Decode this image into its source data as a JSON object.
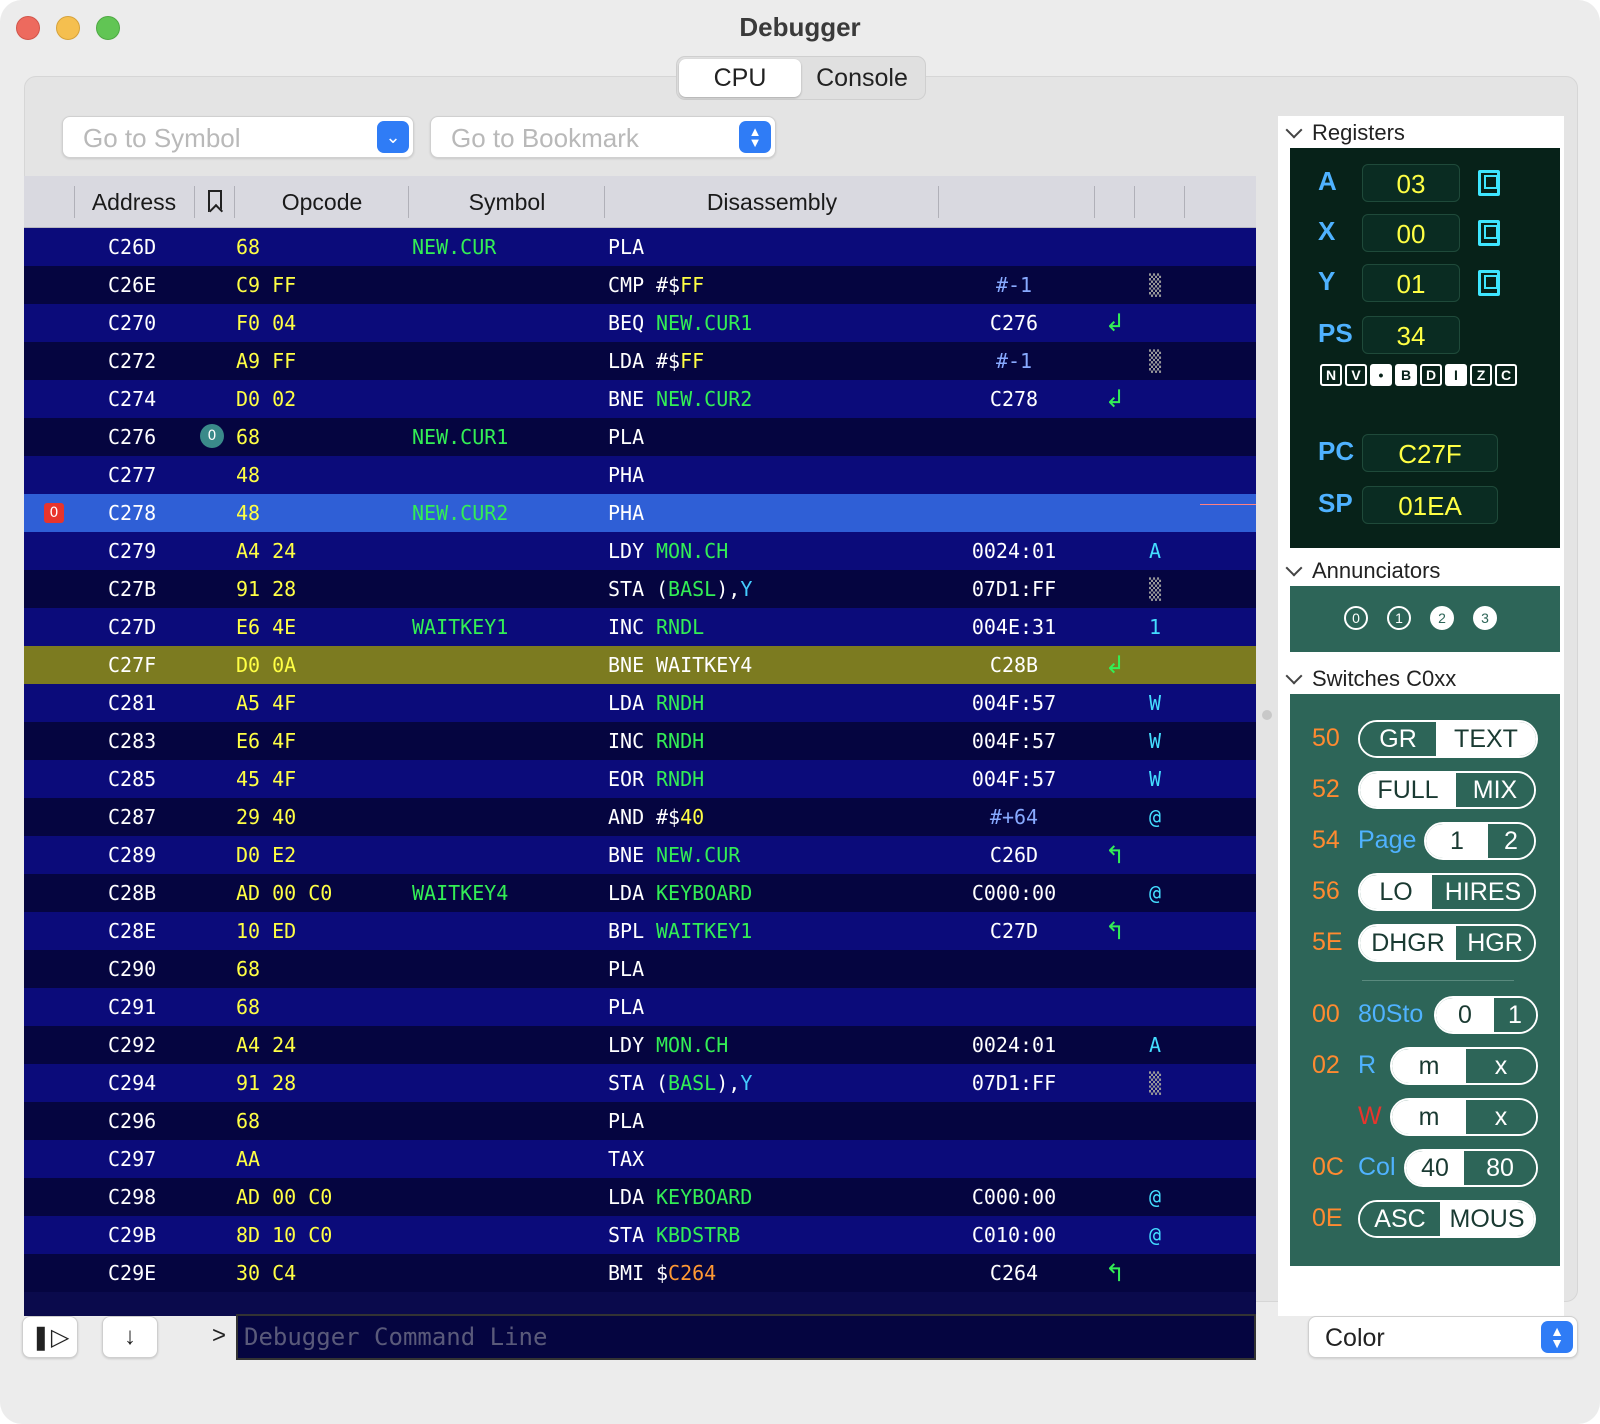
{
  "window": {
    "title": "Debugger"
  },
  "tabs": [
    {
      "label": "CPU",
      "active": true
    },
    {
      "label": "Console",
      "active": false
    }
  ],
  "goto_symbol": {
    "placeholder": "Go to Symbol"
  },
  "goto_bookmark": {
    "placeholder": "Go to Bookmark"
  },
  "columns": {
    "address": "Address",
    "opcode": "Opcode",
    "symbol": "Symbol",
    "disassembly": "Disassembly"
  },
  "rows": [
    {
      "addr": "C26D",
      "op": "68",
      "sym": "NEW.CUR",
      "mn": "PLA",
      "arg": "",
      "argc": "",
      "tgt": "",
      "imm": false,
      "br": "",
      "ch": "",
      "chc": ""
    },
    {
      "addr": "C26E",
      "op": "C9 FF",
      "sym": "",
      "mn": "CMP",
      "arg": "#$FF",
      "argc": "yellow",
      "tgt": "#-1",
      "imm": true,
      "br": "",
      "ch": "▒",
      "chc": "gray"
    },
    {
      "addr": "C270",
      "op": "F0 04",
      "sym": "",
      "mn": "BEQ",
      "arg": "NEW.CUR1",
      "argc": "green",
      "tgt": "C276",
      "imm": false,
      "br": "↲",
      "ch": "",
      "chc": ""
    },
    {
      "addr": "C272",
      "op": "A9 FF",
      "sym": "",
      "mn": "LDA",
      "arg": "#$FF",
      "argc": "yellow",
      "tgt": "#-1",
      "imm": true,
      "br": "",
      "ch": "▒",
      "chc": "gray"
    },
    {
      "addr": "C274",
      "op": "D0 02",
      "sym": "",
      "mn": "BNE",
      "arg": "NEW.CUR2",
      "argc": "green",
      "tgt": "C278",
      "imm": false,
      "br": "↲",
      "ch": "",
      "chc": ""
    },
    {
      "addr": "C276",
      "op": "68",
      "sym": "NEW.CUR1",
      "mn": "PLA",
      "arg": "",
      "argc": "",
      "tgt": "",
      "imm": false,
      "br": "",
      "ch": "",
      "chc": "",
      "bookmark": "0"
    },
    {
      "addr": "C277",
      "op": "48",
      "sym": "",
      "mn": "PHA",
      "arg": "",
      "argc": "",
      "tgt": "",
      "imm": false,
      "br": "",
      "ch": "",
      "chc": ""
    },
    {
      "addr": "C278",
      "op": "48",
      "sym": "NEW.CUR2",
      "mn": "PHA",
      "arg": "",
      "argc": "",
      "tgt": "",
      "imm": false,
      "br": "",
      "ch": "",
      "chc": "",
      "breakpoint": "0",
      "selected": true
    },
    {
      "addr": "C279",
      "op": "A4 24",
      "sym": "",
      "mn": "LDY",
      "arg": "MON.CH",
      "argc": "green",
      "tgt": "0024:01",
      "imm": false,
      "br": "",
      "ch": "A",
      "chc": ""
    },
    {
      "addr": "C27B",
      "op": "91 28",
      "sym": "",
      "mn": "STA",
      "arg": "(BASL),Y",
      "argc": "mixed",
      "tgt": "07D1:FF",
      "imm": false,
      "br": "",
      "ch": "▒",
      "chc": "gray"
    },
    {
      "addr": "C27D",
      "op": "E6 4E",
      "sym": "WAITKEY1",
      "mn": "INC",
      "arg": "RNDL",
      "argc": "green",
      "tgt": "004E:31",
      "imm": false,
      "br": "",
      "ch": "1",
      "chc": ""
    },
    {
      "addr": "C27F",
      "op": "D0 0A",
      "sym": "",
      "mn": "BNE",
      "arg": "WAITKEY4",
      "argc": "white",
      "tgt": "C28B",
      "imm": false,
      "br": "↲",
      "ch": "",
      "chc": "",
      "pc": true
    },
    {
      "addr": "C281",
      "op": "A5 4F",
      "sym": "",
      "mn": "LDA",
      "arg": "RNDH",
      "argc": "green",
      "tgt": "004F:57",
      "imm": false,
      "br": "",
      "ch": "W",
      "chc": ""
    },
    {
      "addr": "C283",
      "op": "E6 4F",
      "sym": "",
      "mn": "INC",
      "arg": "RNDH",
      "argc": "green",
      "tgt": "004F:57",
      "imm": false,
      "br": "",
      "ch": "W",
      "chc": ""
    },
    {
      "addr": "C285",
      "op": "45 4F",
      "sym": "",
      "mn": "EOR",
      "arg": "RNDH",
      "argc": "green",
      "tgt": "004F:57",
      "imm": false,
      "br": "",
      "ch": "W",
      "chc": ""
    },
    {
      "addr": "C287",
      "op": "29 40",
      "sym": "",
      "mn": "AND",
      "arg": "#$40",
      "argc": "yellow",
      "tgt": "#+64",
      "imm": true,
      "br": "",
      "ch": "@",
      "chc": ""
    },
    {
      "addr": "C289",
      "op": "D0 E2",
      "sym": "",
      "mn": "BNE",
      "arg": "NEW.CUR",
      "argc": "green",
      "tgt": "C26D",
      "imm": false,
      "br": "↰",
      "ch": "",
      "chc": ""
    },
    {
      "addr": "C28B",
      "op": "AD 00 C0",
      "sym": "WAITKEY4",
      "mn": "LDA",
      "arg": "KEYBOARD",
      "argc": "green",
      "tgt": "C000:00",
      "imm": false,
      "br": "",
      "ch": "@",
      "chc": ""
    },
    {
      "addr": "C28E",
      "op": "10 ED",
      "sym": "",
      "mn": "BPL",
      "arg": "WAITKEY1",
      "argc": "green",
      "tgt": "C27D",
      "imm": false,
      "br": "↰",
      "ch": "",
      "chc": ""
    },
    {
      "addr": "C290",
      "op": "68",
      "sym": "",
      "mn": "PLA",
      "arg": "",
      "argc": "",
      "tgt": "",
      "imm": false,
      "br": "",
      "ch": "",
      "chc": ""
    },
    {
      "addr": "C291",
      "op": "68",
      "sym": "",
      "mn": "PLA",
      "arg": "",
      "argc": "",
      "tgt": "",
      "imm": false,
      "br": "",
      "ch": "",
      "chc": ""
    },
    {
      "addr": "C292",
      "op": "A4 24",
      "sym": "",
      "mn": "LDY",
      "arg": "MON.CH",
      "argc": "green",
      "tgt": "0024:01",
      "imm": false,
      "br": "",
      "ch": "A",
      "chc": ""
    },
    {
      "addr": "C294",
      "op": "91 28",
      "sym": "",
      "mn": "STA",
      "arg": "(BASL),Y",
      "argc": "mixed",
      "tgt": "07D1:FF",
      "imm": false,
      "br": "",
      "ch": "▒",
      "chc": "gray"
    },
    {
      "addr": "C296",
      "op": "68",
      "sym": "",
      "mn": "PLA",
      "arg": "",
      "argc": "",
      "tgt": "",
      "imm": false,
      "br": "",
      "ch": "",
      "chc": ""
    },
    {
      "addr": "C297",
      "op": "AA",
      "sym": "",
      "mn": "TAX",
      "arg": "",
      "argc": "",
      "tgt": "",
      "imm": false,
      "br": "",
      "ch": "",
      "chc": ""
    },
    {
      "addr": "C298",
      "op": "AD 00 C0",
      "sym": "",
      "mn": "LDA",
      "arg": "KEYBOARD",
      "argc": "green",
      "tgt": "C000:00",
      "imm": false,
      "br": "",
      "ch": "@",
      "chc": ""
    },
    {
      "addr": "C29B",
      "op": "8D 10 C0",
      "sym": "",
      "mn": "STA",
      "arg": "KBDSTRB",
      "argc": "green",
      "tgt": "C010:00",
      "imm": false,
      "br": "",
      "ch": "@",
      "chc": ""
    },
    {
      "addr": "C29E",
      "op": "30 C4",
      "sym": "",
      "mn": "BMI",
      "arg": "$C264",
      "argc": "dollar-orange",
      "tgt": "C264",
      "imm": false,
      "br": "↰",
      "ch": "",
      "chc": ""
    }
  ],
  "registers": {
    "title": "Registers",
    "A": {
      "label": "A",
      "value": "03"
    },
    "X": {
      "label": "X",
      "value": "00"
    },
    "Y": {
      "label": "Y",
      "value": "01"
    },
    "PS": {
      "label": "PS",
      "value": "34"
    },
    "PC": {
      "label": "PC",
      "value": "C27F"
    },
    "SP": {
      "label": "SP",
      "value": "01EA"
    },
    "flags": [
      {
        "label": "N",
        "on": false
      },
      {
        "label": "V",
        "on": false
      },
      {
        "label": "•",
        "on": true
      },
      {
        "label": "B",
        "on": true
      },
      {
        "label": "D",
        "on": false
      },
      {
        "label": "I",
        "on": true
      },
      {
        "label": "Z",
        "on": false
      },
      {
        "label": "C",
        "on": false
      }
    ]
  },
  "annunciators": {
    "title": "Annunciators",
    "items": [
      {
        "label": "0",
        "on": false
      },
      {
        "label": "1",
        "on": false
      },
      {
        "label": "2",
        "on": true
      },
      {
        "label": "3",
        "on": true
      }
    ]
  },
  "switches": {
    "title": "Switches C0xx",
    "rows": [
      {
        "addr": "50",
        "label": "",
        "left": "GR",
        "right": "TEXT",
        "left_on": false
      },
      {
        "addr": "52",
        "label": "",
        "left": "FULL",
        "right": "MIX",
        "left_on": true
      },
      {
        "addr": "54",
        "label": "Page",
        "left": "1",
        "right": "2",
        "left_on": true
      },
      {
        "addr": "56",
        "label": "",
        "left": "LO",
        "right": "HIRES",
        "left_on": true
      },
      {
        "addr": "5E",
        "label": "",
        "left": "DHGR",
        "right": "HGR",
        "left_on": true
      },
      {
        "addr": "00",
        "label": "80Sto",
        "left": "0",
        "right": "1",
        "left_on": true
      },
      {
        "addr": "02",
        "label": "R",
        "left": "m",
        "right": "x",
        "left_on": true
      },
      {
        "addr": "",
        "label": "W",
        "left": "m",
        "right": "x",
        "left_on": true
      },
      {
        "addr": "0C",
        "label": "Col",
        "left": "40",
        "right": "80",
        "left_on": true
      },
      {
        "addr": "0E",
        "label": "ASC",
        "left": "",
        "right": "MOUS",
        "left_on": false
      }
    ]
  },
  "bottom": {
    "prompt": ">",
    "command_placeholder": "Debugger Command Line",
    "color_mode": "Color"
  },
  "colors": {
    "row_even": "#0b0b7a",
    "row_odd": "#050540",
    "row_selected": "#2f5fd6",
    "row_pc": "#7c7b20",
    "switch_panel": "#2d6558"
  }
}
